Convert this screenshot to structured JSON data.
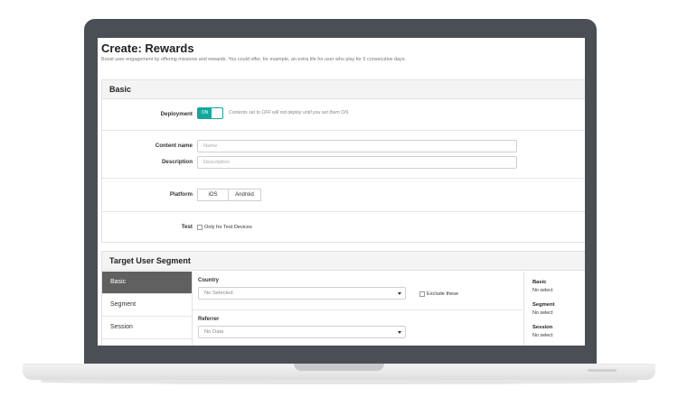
{
  "page": {
    "title": "Create: Rewards",
    "subtitle": "Boost user engagement by offering missions and rewards. You could offer, for example, an extra life for user who play for 5 consecutive days."
  },
  "basic": {
    "header": "Basic",
    "deployment_label": "Deployment",
    "toggle_label": "ON",
    "toggle_state": "on",
    "deployment_hint": "Contents set to OFF will not deploy until you set them ON.",
    "content_name_label": "Content name",
    "content_name_placeholder": "Name",
    "description_label": "Description",
    "description_placeholder": "Description",
    "platform_label": "Platform",
    "platform_options": [
      "iOS",
      "Android"
    ],
    "test_label": "Test",
    "test_checkbox_label": "Only for Test Devices"
  },
  "segment": {
    "header": "Target User Segment",
    "tabs": [
      "Basic",
      "Segment",
      "Session"
    ],
    "active_tab": "Basic",
    "country_label": "Country",
    "country_value": "No Selected",
    "exclude_label": "Exclude these",
    "referrer_label": "Referrer",
    "referrer_value": "No Data",
    "summary": [
      {
        "title": "Basic",
        "value": "No select"
      },
      {
        "title": "Segment",
        "value": "No select"
      },
      {
        "title": "Session",
        "value": "No select"
      }
    ]
  },
  "colors": {
    "accent": "#13a89e",
    "bezel": "#4a4f56",
    "active_tab": "#606060"
  }
}
